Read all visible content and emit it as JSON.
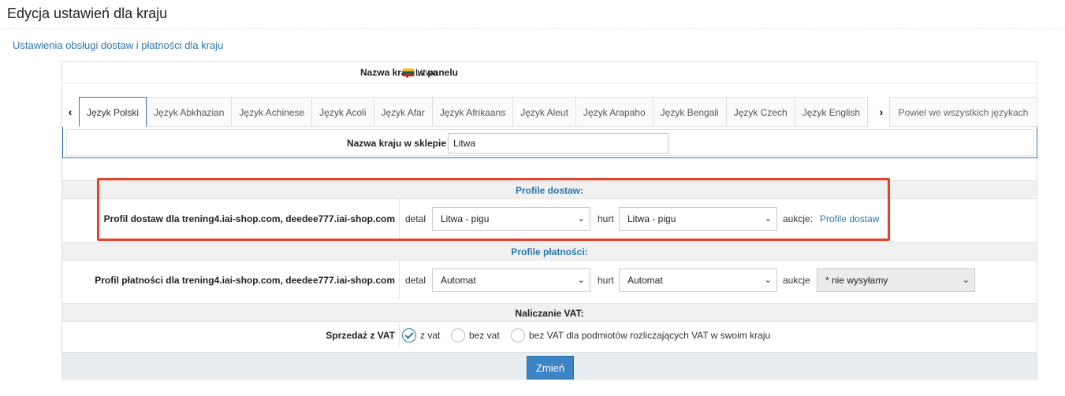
{
  "page": {
    "title": "Edycja ustawień dla kraju",
    "section_link": "Ustawienia obsługi dostaw i płatności dla kraju"
  },
  "panel_name": {
    "label": "Nazwa kraju w panelu",
    "value": "Litwa",
    "flag_icon": "lithuania-flag-icon"
  },
  "tabs": {
    "prev_icon": "‹",
    "next_icon": "›",
    "items": [
      {
        "label": "Język Polski",
        "active": true
      },
      {
        "label": "Język Abkhazian"
      },
      {
        "label": "Język Achinese"
      },
      {
        "label": "Język Acoli"
      },
      {
        "label": "Język Afar"
      },
      {
        "label": "Język Afrikaans"
      },
      {
        "label": "Język Aleut"
      },
      {
        "label": "Język Arapaho"
      },
      {
        "label": "Język Bengali"
      },
      {
        "label": "Język Czech"
      },
      {
        "label": "Język English"
      }
    ],
    "apply_all": "Powiel we wszystkich językach"
  },
  "shop_name": {
    "label": "Nazwa kraju w sklepie",
    "value": "Litwa"
  },
  "delivery": {
    "header": "Profile dostaw:",
    "label": "Profil dostaw dla trening4.iai-shop.com, deedee777.iai-shop.com",
    "detal_label": "detal",
    "detal_value": "Litwa - pigu",
    "hurt_label": "hurt",
    "hurt_value": "Litwa - pigu",
    "auction_label": "aukcje:",
    "auction_link": "Profile dostaw"
  },
  "payment": {
    "header": "Profile płatności:",
    "label": "Profil płatności dla trening4.iai-shop.com, deedee777.iai-shop.com",
    "detal_label": "detal",
    "detal_value": "Automat",
    "hurt_label": "hurt",
    "hurt_value": "Automat",
    "auction_label": "aukcje",
    "auction_value": "* nie wysyłamy"
  },
  "vat": {
    "header": "Naliczanie VAT:",
    "label": "Sprzedaż z VAT",
    "options": [
      {
        "label": "z vat",
        "checked": true
      },
      {
        "label": "bez vat",
        "checked": false
      },
      {
        "label": "bez VAT dla podmiotów rozliczających VAT w swoim kraju",
        "checked": false
      }
    ]
  },
  "submit_label": "Zmień",
  "colors": {
    "accent": "#2a76b3",
    "highlight": "#e8402a",
    "button": "#3d84c6"
  }
}
